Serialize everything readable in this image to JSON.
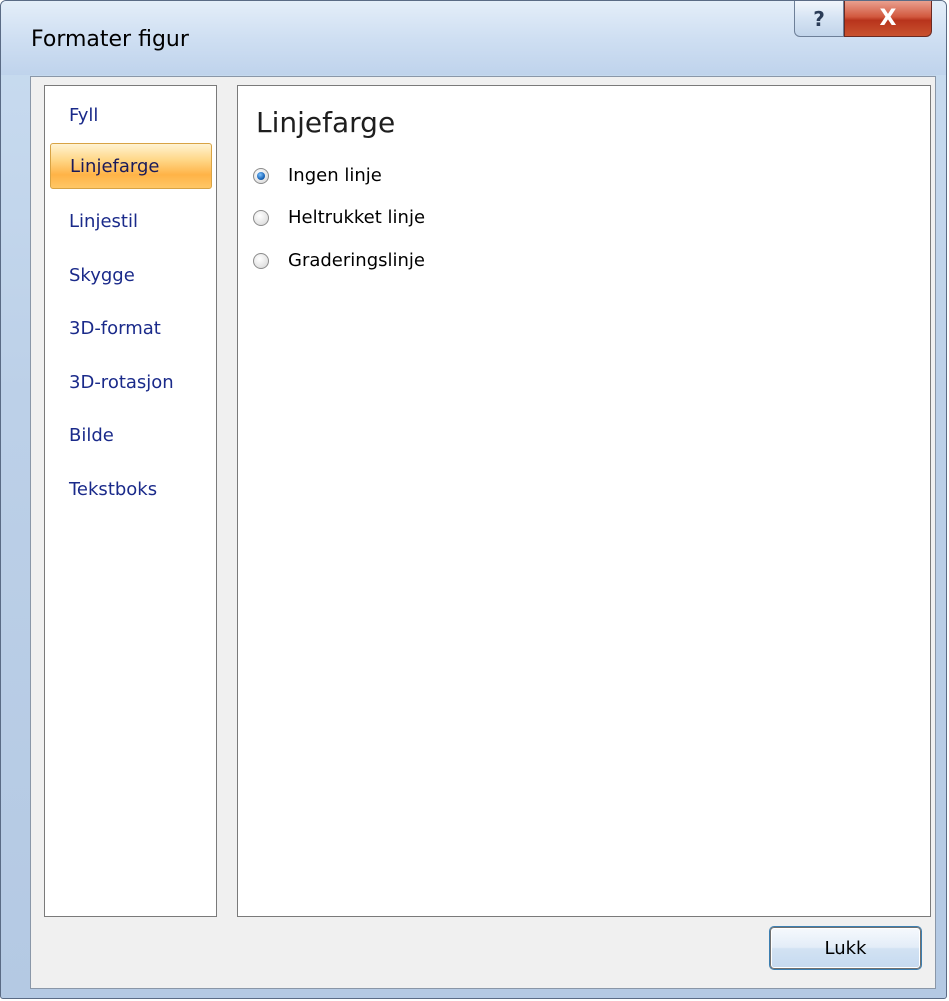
{
  "window": {
    "title": "Formater figur",
    "help_glyph": "?",
    "close_glyph": "X"
  },
  "nav": {
    "items": [
      {
        "label": "Fyll",
        "selected": false
      },
      {
        "label": "Linjefarge",
        "selected": true
      },
      {
        "label": "Linjestil",
        "selected": false
      },
      {
        "label": "Skygge",
        "selected": false
      },
      {
        "label": "3D-format",
        "selected": false
      },
      {
        "label": "3D-rotasjon",
        "selected": false
      },
      {
        "label": "Bilde",
        "selected": false
      },
      {
        "label": "Tekstboks",
        "selected": false
      }
    ]
  },
  "panel": {
    "title": "Linjefarge",
    "options": [
      {
        "label": "Ingen linje",
        "checked": true
      },
      {
        "label": "Heltrukket linje",
        "checked": false
      },
      {
        "label": "Graderingslinje",
        "checked": false
      }
    ]
  },
  "footer": {
    "close_label": "Lukk"
  },
  "colors": {
    "nav_text": "#1a2a8a",
    "selected_highlight": "#ffb347",
    "close_button_red": "#c9522f"
  }
}
